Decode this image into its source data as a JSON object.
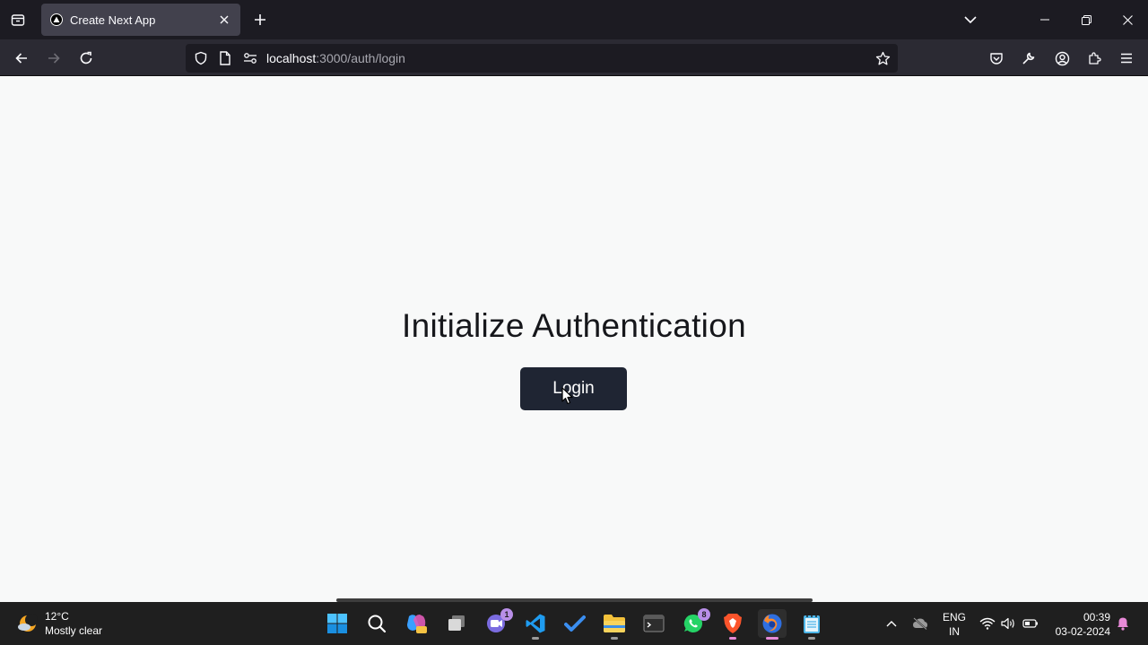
{
  "browser": {
    "tab": {
      "title": "Create Next App"
    },
    "url": {
      "host": "localhost",
      "path": ":3000/auth/login"
    }
  },
  "page": {
    "heading": "Initialize Authentication",
    "login_label": "Login"
  },
  "taskbar": {
    "weather": {
      "temperature": "12°C",
      "condition": "Mostly clear"
    },
    "badges": {
      "teams": "1",
      "whatsapp": "8"
    },
    "language": {
      "line1": "ENG",
      "line2": "IN"
    },
    "clock": {
      "time": "00:39",
      "date": "03-02-2024"
    }
  },
  "colors": {
    "tab_strip": "#1c1b22",
    "nav_bar": "#2b2a33",
    "page_bg": "#f8f9f9",
    "button_bg": "#1f2533",
    "taskbar": "#1f1f1f"
  },
  "icons": [
    "tab-list-icon",
    "nextjs-favicon-icon",
    "close-icon",
    "plus-icon",
    "chevron-down-icon",
    "minimize-icon",
    "restore-icon",
    "window-close-icon",
    "back-arrow-icon",
    "forward-arrow-icon",
    "reload-icon",
    "shield-icon",
    "page-icon",
    "permissions-icon",
    "star-icon",
    "pocket-icon",
    "wrench-icon",
    "account-icon",
    "extensions-icon",
    "menu-icon",
    "windows-start-icon",
    "search-icon",
    "copilot-icon",
    "task-view-icon",
    "teams-icon",
    "vscode-icon",
    "todo-icon",
    "file-explorer-icon",
    "terminal-icon",
    "whatsapp-icon",
    "brave-icon",
    "firefox-icon",
    "notepad-icon",
    "chevron-up-icon",
    "cloud-offline-icon",
    "wifi-icon",
    "volume-icon",
    "battery-icon",
    "notification-bell-icon"
  ]
}
